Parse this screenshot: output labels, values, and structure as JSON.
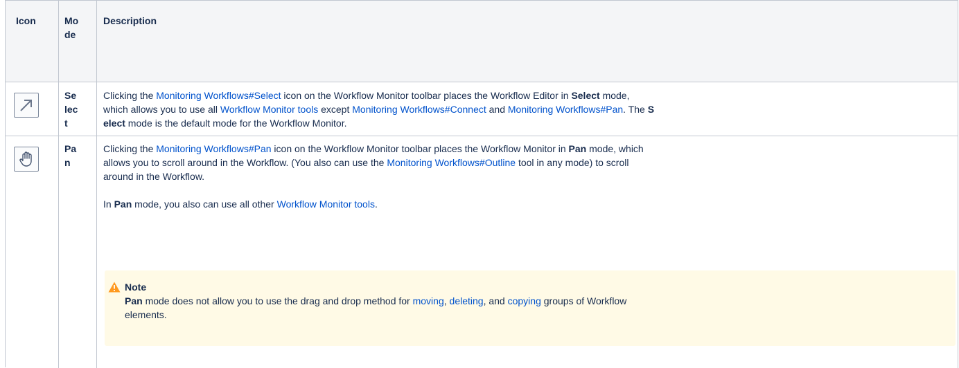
{
  "table": {
    "headers": {
      "icon": "Icon",
      "mode": "Mode",
      "description": "Description"
    },
    "rows": [
      {
        "icon_name": "arrow-up-right-icon",
        "mode": "Select",
        "desc": {
          "t1": "Clicking the ",
          "link1": "Monitoring Workflows#Select",
          "t2": " icon on the Workflow Monitor toolbar places the Workflow Editor in ",
          "b1": "Select",
          "t3": " mode,",
          "t4": "which allows you to use all ",
          "link2": "Workflow Monitor tools",
          "t5": " except ",
          "link3": "Monitoring Workflows#Connect",
          "t6": " and ",
          "link4": "Monitoring Workflows#Pan",
          "t7": ". The ",
          "b2": "S",
          "b3": "elect",
          "t8": " mode is the default mode for the Workflow Monitor."
        }
      },
      {
        "icon_name": "hand-pan-icon",
        "mode": "Pan",
        "desc": {
          "t1": "Clicking the ",
          "link1": "Monitoring Workflows#Pan",
          "t2": " icon on the Workflow Monitor toolbar places the Workflow Monitor in ",
          "b1": "Pan",
          "t3": " mode, which",
          "t4": "allows you to scroll around in the Workflow. (You also can use the ",
          "link2": "Monitoring Workflows#Outline",
          "t5": " tool in any mode) to scroll",
          "t6": "around in the Workflow.",
          "p2_t1": "In ",
          "p2_b1": "Pan",
          "p2_t2": " mode, you also can use all other ",
          "p2_link1": "Workflow Monitor tools",
          "p2_t3": "."
        },
        "note": {
          "title": "Note",
          "b1": "Pan",
          "t1": " mode does not allow you to use the drag and drop method for ",
          "link1": "moving",
          "t2": ", ",
          "link2": "deleting",
          "t3": ", and ",
          "link3": "copying",
          "t4": " groups of Workflow",
          "t5": "elements."
        }
      }
    ]
  },
  "colors": {
    "link": "#0052cc",
    "note_bg": "#fffae6",
    "header_bg": "#f4f5f7",
    "warning": "#ff991f"
  }
}
